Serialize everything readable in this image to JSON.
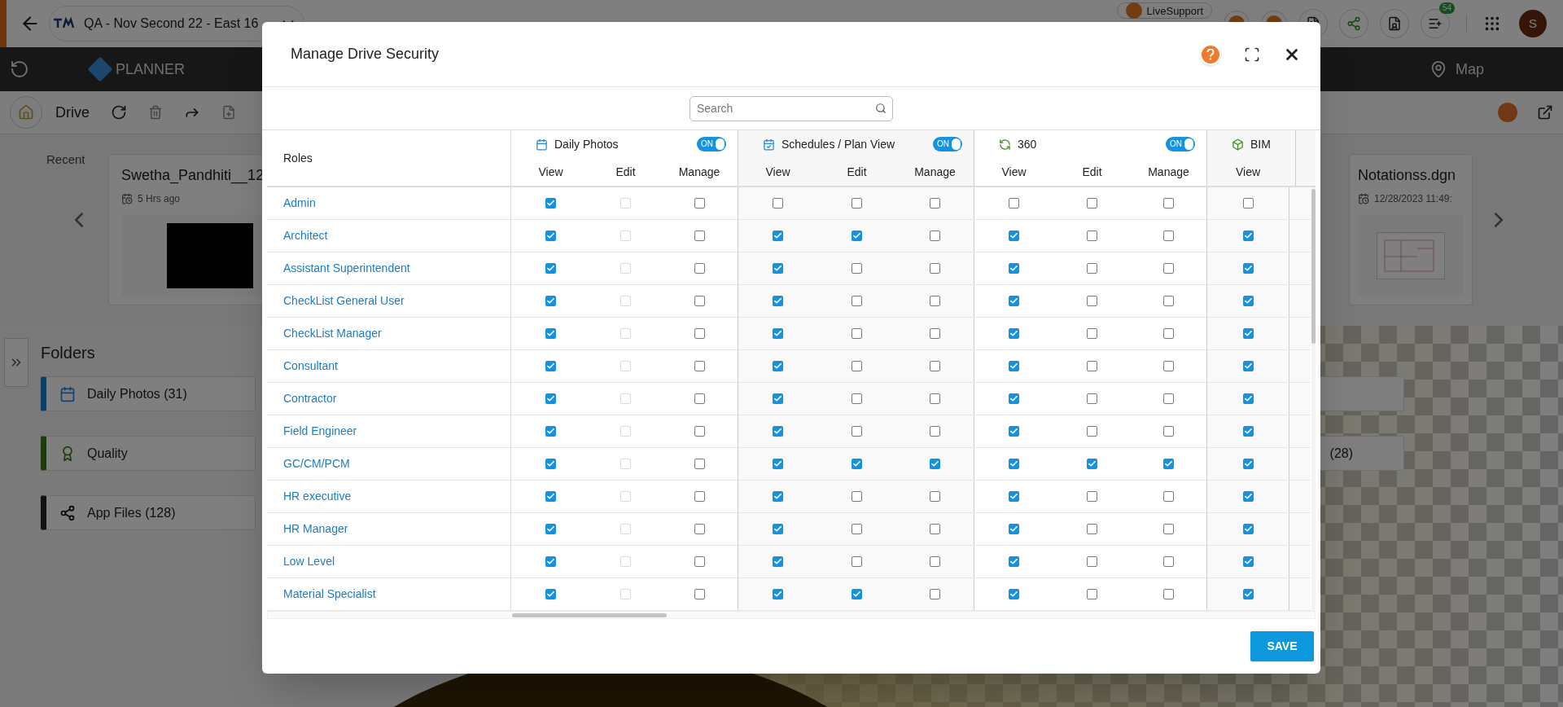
{
  "app": {
    "title": "QA - Nov Second 22 - East 16",
    "live_support": "LiveSupport",
    "notification_count": "54",
    "avatar_initial": "S",
    "brand": "PLANNER",
    "map": "Map",
    "toolbar_title": "Drive"
  },
  "recent": {
    "label": "Recent",
    "files": [
      {
        "name": "Swetha_Pandhiti__12",
        "time": "5 Hrs ago",
        "kind": "dark"
      },
      {
        "name": "Notationss.dgn",
        "time": "12/28/2023 11:49:",
        "kind": "drawing"
      }
    ]
  },
  "folders": {
    "title": "Folders",
    "items": [
      {
        "label": "Daily Photos (31)",
        "kind": "calendar"
      },
      {
        "label": "Quality",
        "kind": "award"
      },
      {
        "label": "App Files (128)",
        "kind": "app"
      }
    ],
    "right_items": [
      {
        "label": "(28)"
      }
    ]
  },
  "modal": {
    "title": "Manage Drive Security",
    "search": {
      "placeholder": "Search"
    },
    "save": "SAVE",
    "table": {
      "roles_header": "Roles",
      "groups": [
        {
          "label": "Daily Photos",
          "kind": "calendar",
          "toggle": {
            "on": true,
            "label": "ON"
          },
          "columns": [
            "View",
            "Edit",
            "Manage"
          ]
        },
        {
          "label": "Schedules / Plan View",
          "kind": "schedule",
          "toggle": {
            "on": true,
            "label": "ON"
          },
          "columns": [
            "View",
            "Edit",
            "Manage"
          ]
        },
        {
          "label": "360",
          "kind": "rotate",
          "toggle": {
            "on": true,
            "label": "ON"
          },
          "columns": [
            "View",
            "Edit",
            "Manage"
          ]
        },
        {
          "label": "BIM",
          "kind": "cube",
          "columns": [
            "View"
          ]
        }
      ],
      "rows": [
        {
          "role": "Admin",
          "cells": [
            {
              "checked": true,
              "disabled": false
            },
            {
              "checked": false,
              "disabled": true
            },
            {
              "checked": false,
              "disabled": false
            },
            {
              "checked": false,
              "disabled": false
            },
            {
              "checked": false,
              "disabled": false
            },
            {
              "checked": false,
              "disabled": false
            },
            {
              "checked": false,
              "disabled": false
            },
            {
              "checked": false,
              "disabled": false
            },
            {
              "checked": false,
              "disabled": false
            },
            {
              "checked": false,
              "disabled": false
            }
          ]
        },
        {
          "role": "Architect",
          "cells": [
            {
              "checked": true,
              "disabled": false
            },
            {
              "checked": false,
              "disabled": true
            },
            {
              "checked": false,
              "disabled": false
            },
            {
              "checked": true,
              "disabled": false
            },
            {
              "checked": true,
              "disabled": false
            },
            {
              "checked": false,
              "disabled": false
            },
            {
              "checked": true,
              "disabled": false
            },
            {
              "checked": false,
              "disabled": false
            },
            {
              "checked": false,
              "disabled": false
            },
            {
              "checked": true,
              "disabled": false
            }
          ]
        },
        {
          "role": "Assistant Superintendent",
          "cells": [
            {
              "checked": true,
              "disabled": false
            },
            {
              "checked": false,
              "disabled": true
            },
            {
              "checked": false,
              "disabled": false
            },
            {
              "checked": true,
              "disabled": false
            },
            {
              "checked": false,
              "disabled": false
            },
            {
              "checked": false,
              "disabled": false
            },
            {
              "checked": true,
              "disabled": false
            },
            {
              "checked": false,
              "disabled": false
            },
            {
              "checked": false,
              "disabled": false
            },
            {
              "checked": true,
              "disabled": false
            }
          ]
        },
        {
          "role": "CheckList General User",
          "cells": [
            {
              "checked": true,
              "disabled": false
            },
            {
              "checked": false,
              "disabled": true
            },
            {
              "checked": false,
              "disabled": false
            },
            {
              "checked": true,
              "disabled": false
            },
            {
              "checked": false,
              "disabled": false
            },
            {
              "checked": false,
              "disabled": false
            },
            {
              "checked": true,
              "disabled": false
            },
            {
              "checked": false,
              "disabled": false
            },
            {
              "checked": false,
              "disabled": false
            },
            {
              "checked": true,
              "disabled": false
            }
          ]
        },
        {
          "role": "CheckList Manager",
          "cells": [
            {
              "checked": true,
              "disabled": false
            },
            {
              "checked": false,
              "disabled": true
            },
            {
              "checked": false,
              "disabled": false
            },
            {
              "checked": true,
              "disabled": false
            },
            {
              "checked": false,
              "disabled": false
            },
            {
              "checked": false,
              "disabled": false
            },
            {
              "checked": true,
              "disabled": false
            },
            {
              "checked": false,
              "disabled": false
            },
            {
              "checked": false,
              "disabled": false
            },
            {
              "checked": true,
              "disabled": false
            }
          ]
        },
        {
          "role": "Consultant",
          "cells": [
            {
              "checked": true,
              "disabled": false
            },
            {
              "checked": false,
              "disabled": true
            },
            {
              "checked": false,
              "disabled": false
            },
            {
              "checked": true,
              "disabled": false
            },
            {
              "checked": false,
              "disabled": false
            },
            {
              "checked": false,
              "disabled": false
            },
            {
              "checked": true,
              "disabled": false
            },
            {
              "checked": false,
              "disabled": false
            },
            {
              "checked": false,
              "disabled": false
            },
            {
              "checked": true,
              "disabled": false
            }
          ]
        },
        {
          "role": "Contractor",
          "cells": [
            {
              "checked": true,
              "disabled": false
            },
            {
              "checked": false,
              "disabled": true
            },
            {
              "checked": false,
              "disabled": false
            },
            {
              "checked": true,
              "disabled": false
            },
            {
              "checked": false,
              "disabled": false
            },
            {
              "checked": false,
              "disabled": false
            },
            {
              "checked": true,
              "disabled": false
            },
            {
              "checked": false,
              "disabled": false
            },
            {
              "checked": false,
              "disabled": false
            },
            {
              "checked": true,
              "disabled": false
            }
          ]
        },
        {
          "role": "Field Engineer",
          "cells": [
            {
              "checked": true,
              "disabled": false
            },
            {
              "checked": false,
              "disabled": true
            },
            {
              "checked": false,
              "disabled": false
            },
            {
              "checked": true,
              "disabled": false
            },
            {
              "checked": false,
              "disabled": false
            },
            {
              "checked": false,
              "disabled": false
            },
            {
              "checked": true,
              "disabled": false
            },
            {
              "checked": false,
              "disabled": false
            },
            {
              "checked": false,
              "disabled": false
            },
            {
              "checked": true,
              "disabled": false
            }
          ]
        },
        {
          "role": "GC/CM/PCM",
          "cells": [
            {
              "checked": true,
              "disabled": false
            },
            {
              "checked": false,
              "disabled": true
            },
            {
              "checked": false,
              "disabled": false
            },
            {
              "checked": true,
              "disabled": false
            },
            {
              "checked": true,
              "disabled": false
            },
            {
              "checked": true,
              "disabled": false
            },
            {
              "checked": true,
              "disabled": false
            },
            {
              "checked": true,
              "disabled": false
            },
            {
              "checked": true,
              "disabled": false
            },
            {
              "checked": true,
              "disabled": false
            }
          ]
        },
        {
          "role": "HR executive",
          "cells": [
            {
              "checked": true,
              "disabled": false
            },
            {
              "checked": false,
              "disabled": true
            },
            {
              "checked": false,
              "disabled": false
            },
            {
              "checked": true,
              "disabled": false
            },
            {
              "checked": false,
              "disabled": false
            },
            {
              "checked": false,
              "disabled": false
            },
            {
              "checked": true,
              "disabled": false
            },
            {
              "checked": false,
              "disabled": false
            },
            {
              "checked": false,
              "disabled": false
            },
            {
              "checked": true,
              "disabled": false
            }
          ]
        },
        {
          "role": "HR Manager",
          "cells": [
            {
              "checked": true,
              "disabled": false
            },
            {
              "checked": false,
              "disabled": true
            },
            {
              "checked": false,
              "disabled": false
            },
            {
              "checked": true,
              "disabled": false
            },
            {
              "checked": false,
              "disabled": false
            },
            {
              "checked": false,
              "disabled": false
            },
            {
              "checked": true,
              "disabled": false
            },
            {
              "checked": false,
              "disabled": false
            },
            {
              "checked": false,
              "disabled": false
            },
            {
              "checked": true,
              "disabled": false
            }
          ]
        },
        {
          "role": "Low Level",
          "cells": [
            {
              "checked": true,
              "disabled": false
            },
            {
              "checked": false,
              "disabled": true
            },
            {
              "checked": false,
              "disabled": false
            },
            {
              "checked": true,
              "disabled": false
            },
            {
              "checked": false,
              "disabled": false
            },
            {
              "checked": false,
              "disabled": false
            },
            {
              "checked": true,
              "disabled": false
            },
            {
              "checked": false,
              "disabled": false
            },
            {
              "checked": false,
              "disabled": false
            },
            {
              "checked": true,
              "disabled": false
            }
          ]
        },
        {
          "role": "Material Specialist",
          "cells": [
            {
              "checked": true,
              "disabled": false
            },
            {
              "checked": false,
              "disabled": true
            },
            {
              "checked": false,
              "disabled": false
            },
            {
              "checked": true,
              "disabled": false
            },
            {
              "checked": true,
              "disabled": false
            },
            {
              "checked": false,
              "disabled": false
            },
            {
              "checked": true,
              "disabled": false
            },
            {
              "checked": false,
              "disabled": false
            },
            {
              "checked": false,
              "disabled": false
            },
            {
              "checked": true,
              "disabled": false
            }
          ]
        }
      ]
    }
  }
}
